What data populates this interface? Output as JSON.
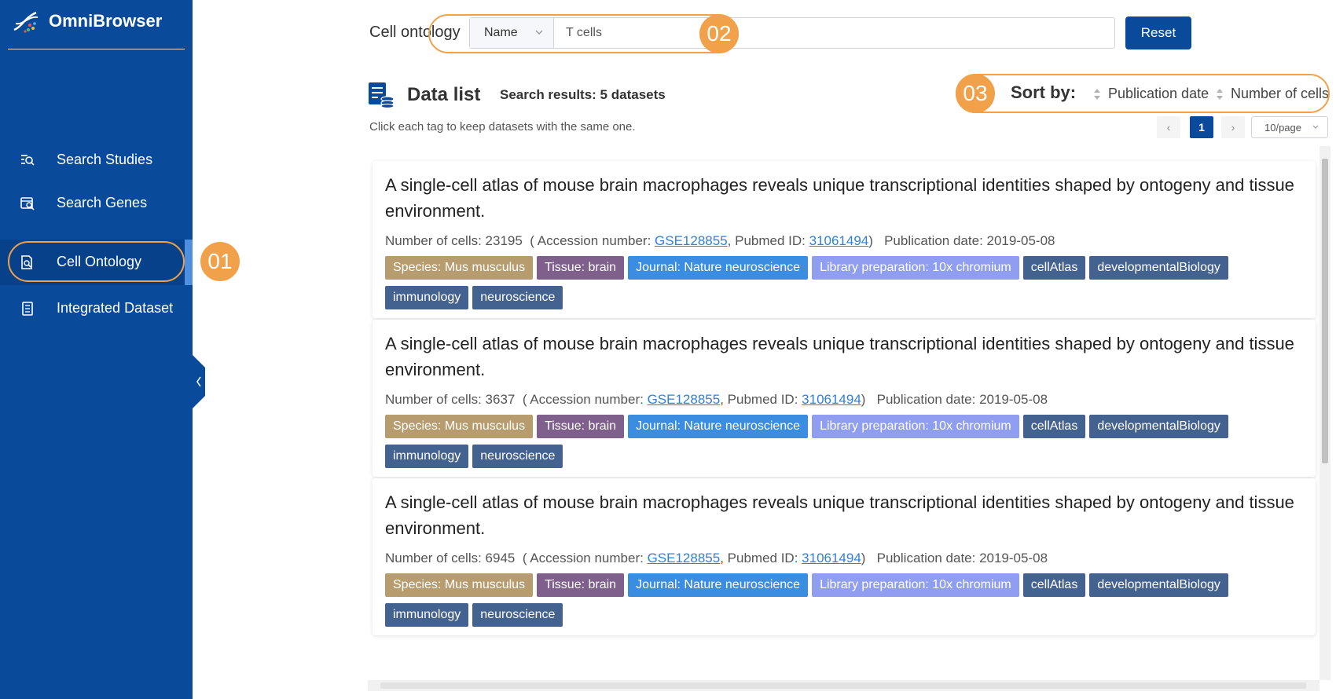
{
  "app": {
    "name": "OmniBrowser"
  },
  "sidebar": {
    "items": [
      {
        "label": "Search Studies",
        "icon": "search-list-icon"
      },
      {
        "label": "Search Genes",
        "icon": "search-doc-icon"
      },
      {
        "label": "Cell Ontology",
        "icon": "cell-search-icon",
        "active": true
      },
      {
        "label": "Integrated Dataset",
        "icon": "document-list-icon"
      }
    ]
  },
  "search": {
    "label": "Cell ontology",
    "select_value": "Name",
    "input_value": "T cells",
    "reset_label": "Reset"
  },
  "data_list": {
    "title": "Data list",
    "results": "Search results: 5 datasets",
    "hint": "Click each tag to keep datasets with the same one."
  },
  "sort": {
    "label": "Sort by:",
    "options": [
      "Publication date",
      "Number of cells"
    ]
  },
  "pagination": {
    "prev": "‹",
    "current": "1",
    "next": "›",
    "page_size": "10/page"
  },
  "cards": [
    {
      "title": "A single-cell atlas of mouse brain macrophages reveals unique transcriptional identities shaped by ontogeny and tissue environment.",
      "cells_label": "Number of cells: 23195",
      "accession_label": "( Accession number: ",
      "accession": "GSE128855",
      "pubmed_label": ", Pubmed ID: ",
      "pubmed": "31061494",
      "date_label": "Publication date: 2019-05-08",
      "tags": [
        "Species: Mus musculus",
        "Tissue: brain",
        "Journal: Nature neuroscience",
        "Library preparation: 10x chromium",
        "cellAtlas",
        "developmentalBiology",
        "immunology",
        "neuroscience"
      ]
    },
    {
      "title": "A single-cell atlas of mouse brain macrophages reveals unique transcriptional identities shaped by ontogeny and tissue environment.",
      "cells_label": "Number of cells: 3637",
      "accession_label": "( Accession number: ",
      "accession": "GSE128855",
      "pubmed_label": ", Pubmed ID: ",
      "pubmed": "31061494",
      "date_label": "Publication date: 2019-05-08",
      "tags": [
        "Species: Mus musculus",
        "Tissue: brain",
        "Journal: Nature neuroscience",
        "Library preparation: 10x chromium",
        "cellAtlas",
        "developmentalBiology",
        "immunology",
        "neuroscience"
      ]
    },
    {
      "title": "A single-cell atlas of mouse brain macrophages reveals unique transcriptional identities shaped by ontogeny and tissue environment.",
      "cells_label": "Number of cells: 6945",
      "accession_label": "( Accession number: ",
      "accession": "GSE128855",
      "pubmed_label": ", Pubmed ID: ",
      "pubmed": "31061494",
      "date_label": "Publication date: 2019-05-08",
      "tags": [
        "Species: Mus musculus",
        "Tissue: brain",
        "Journal: Nature neuroscience",
        "Library preparation: 10x chromium",
        "cellAtlas",
        "developmentalBiology",
        "immunology",
        "neuroscience"
      ]
    }
  ],
  "tag_colors": [
    "#b69c6e",
    "#7f5f8c",
    "#3a8de0",
    "#8f9ef0",
    "#44628f",
    "#44628f",
    "#44628f",
    "#44628f"
  ],
  "callouts": [
    "01",
    "02",
    "03"
  ],
  "colors": {
    "sidebar": "#0a4a9a",
    "accent": "#0a4a9a",
    "callout": "#f0a14a",
    "link": "#2f7fdc"
  }
}
